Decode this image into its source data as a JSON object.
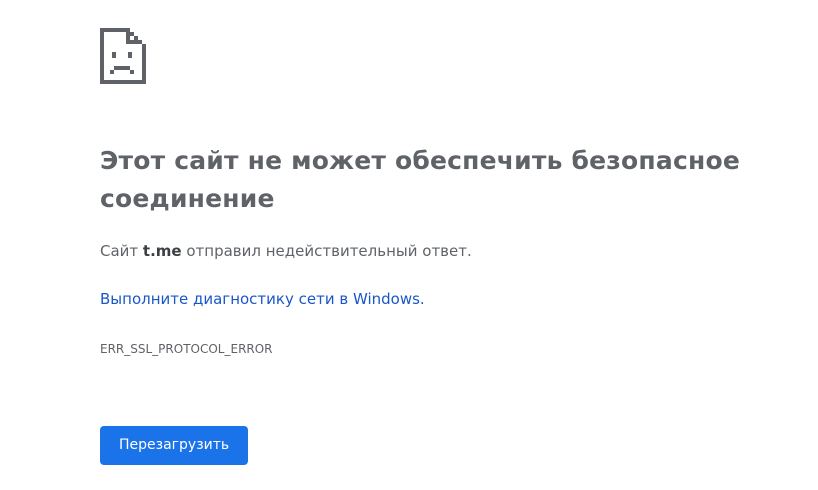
{
  "icon": {
    "name": "sad-page-icon",
    "color": "#5f6368"
  },
  "title": "Этот сайт не может обеспечить безопасное соединение",
  "message": {
    "prefix": "Сайт ",
    "host": "t.me",
    "suffix": " отправил недействительный ответ."
  },
  "diagnostics_link": "Выполните диагностику сети в Windows.",
  "error_code": "ERR_SSL_PROTOCOL_ERROR",
  "reload_button": "Перезагрузить",
  "colors": {
    "text": "#5f6368",
    "link": "#1a56c9",
    "button_bg": "#1a73e8",
    "button_text": "#ffffff"
  }
}
